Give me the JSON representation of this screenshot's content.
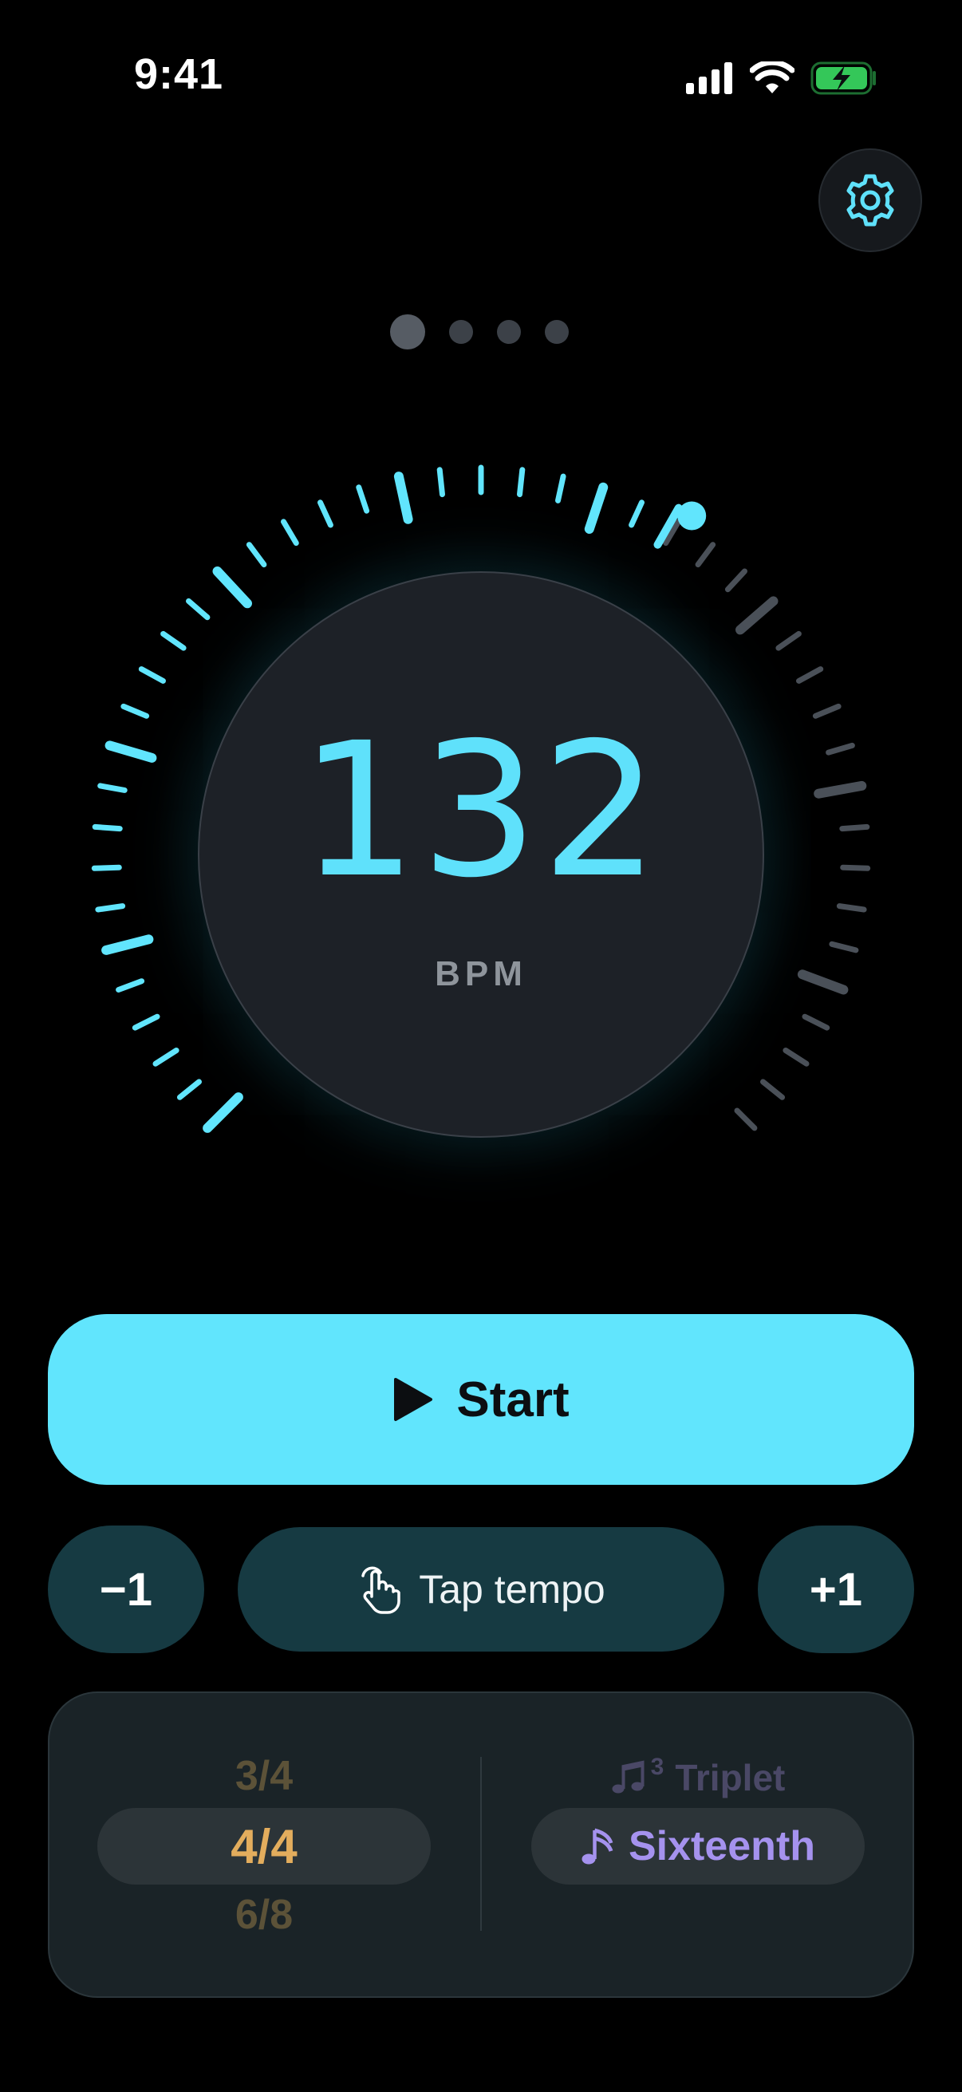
{
  "status_bar": {
    "time": "9:41",
    "battery_color": "#34c759"
  },
  "settings": {
    "icon": "gear-icon"
  },
  "pager": {
    "page_count": 4,
    "active_index": 0
  },
  "tempo": {
    "value": "132",
    "unit": "BPM",
    "dial_fraction": 0.61
  },
  "start_button": {
    "label": "Start",
    "icon": "play-icon"
  },
  "controls": {
    "minus_label": "−1",
    "plus_label": "+1",
    "tap_label": "Tap tempo",
    "tap_icon": "hand-tap-icon"
  },
  "time_signature": {
    "options": [
      "3/4",
      "4/4",
      "6/8"
    ],
    "selected": "4/4"
  },
  "subdivision": {
    "above_label": "Triplet",
    "above_icon": "triplet-note-icon",
    "above_superscript": "3",
    "selected_label": "Sixteenth",
    "selected_icon": "sixteenth-note-icon"
  },
  "colors": {
    "accent": "#61e5fd",
    "time_signature": "#e3ad5d",
    "subdivision": "#a592ee"
  }
}
